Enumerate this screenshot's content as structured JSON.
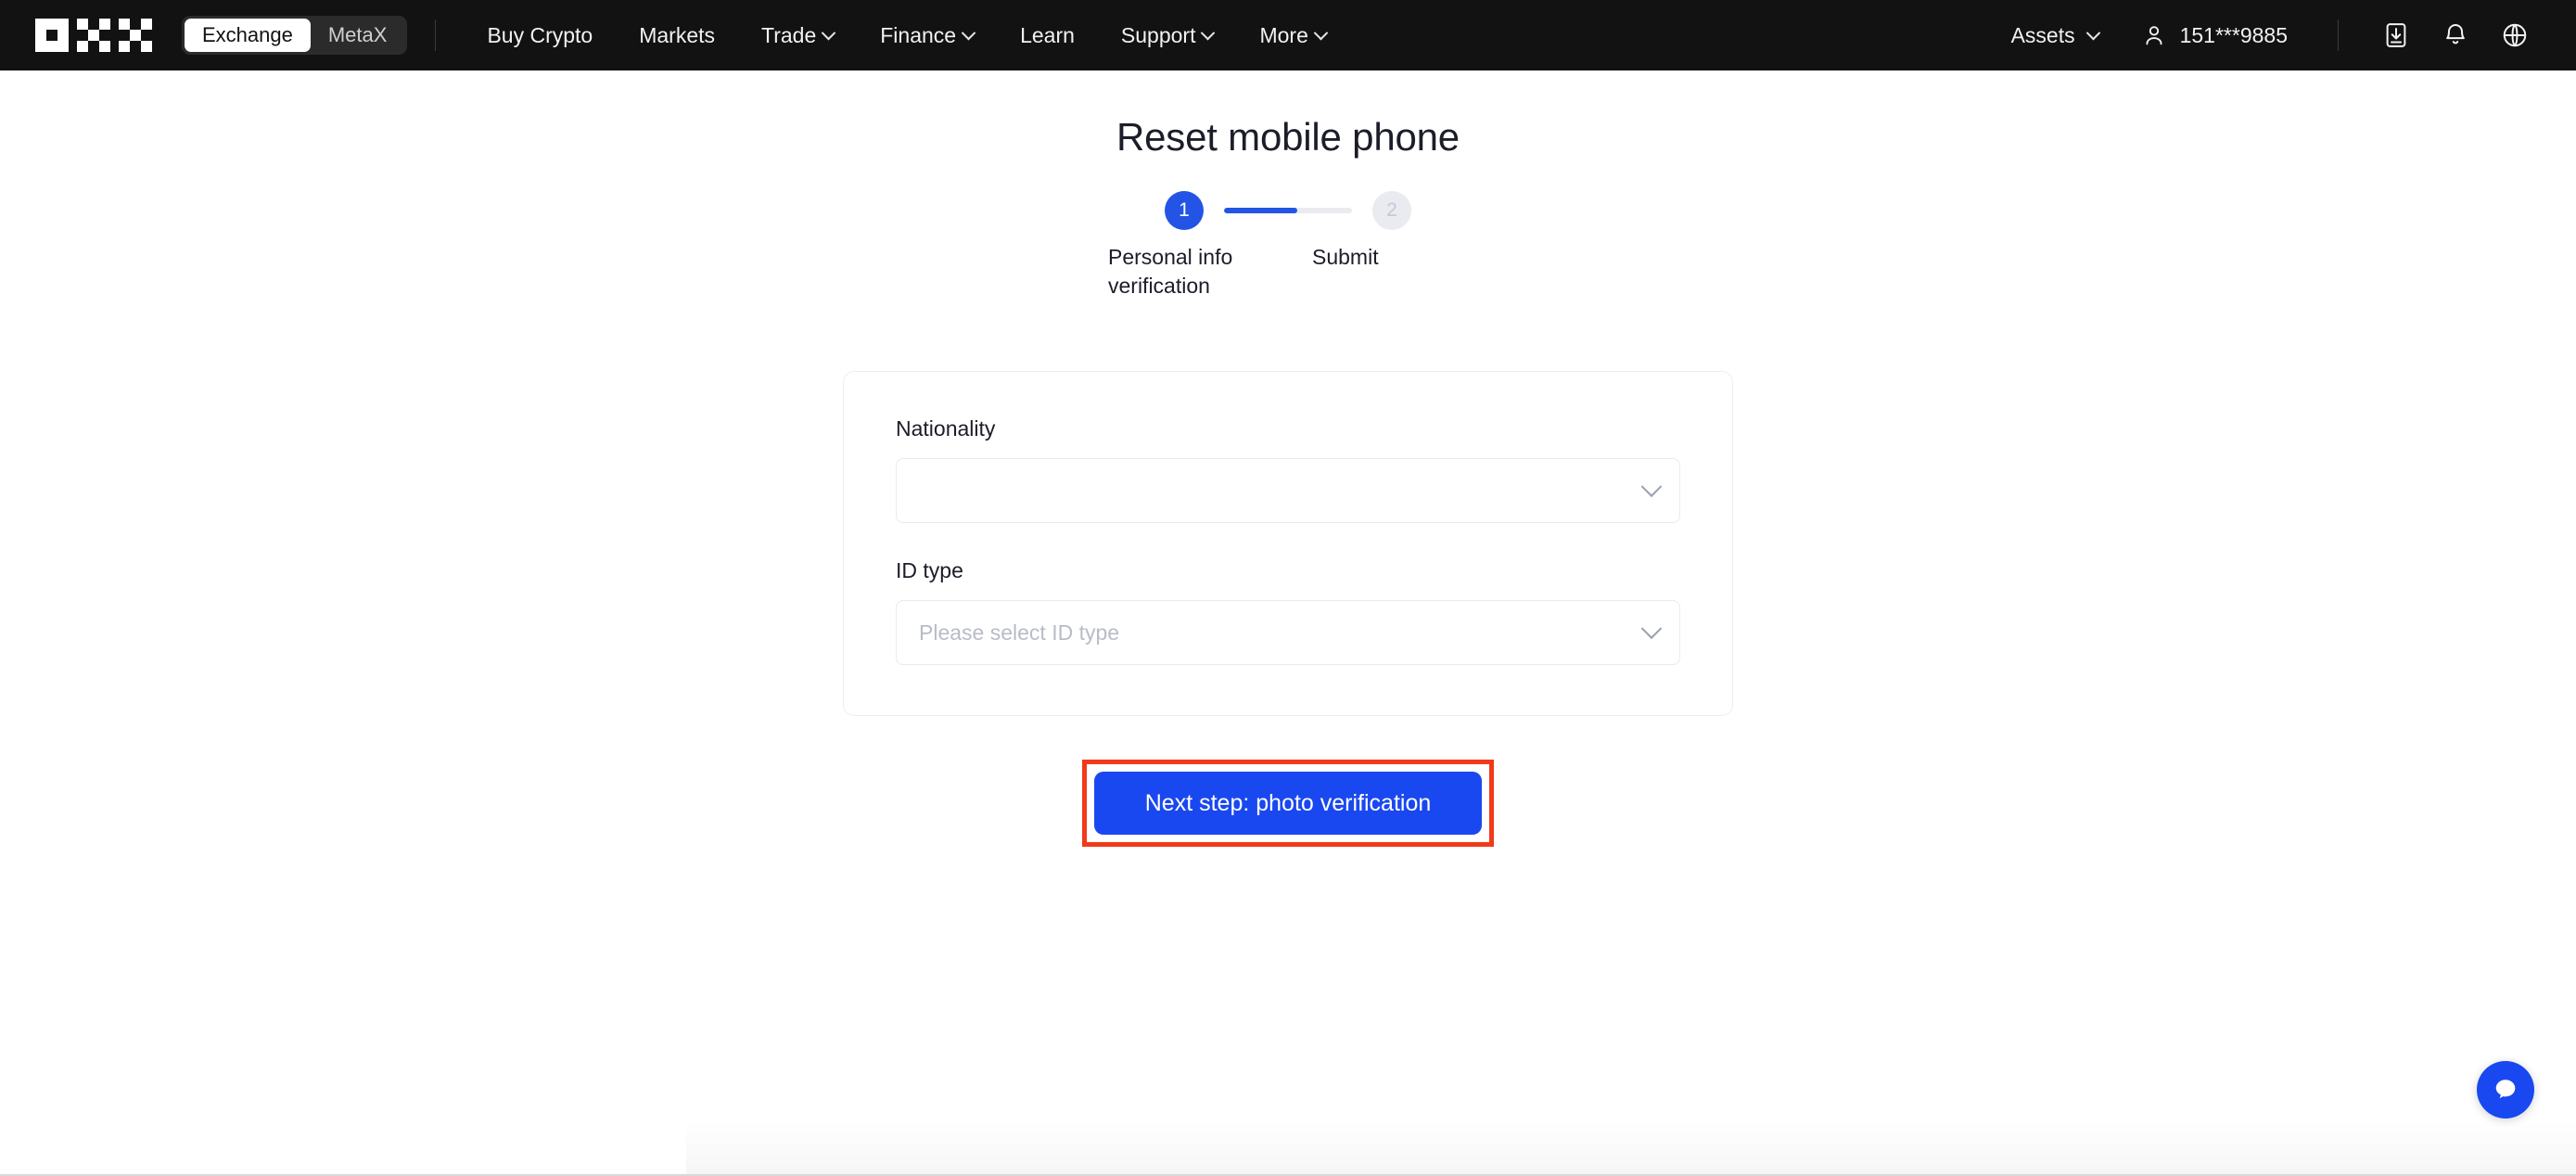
{
  "header": {
    "logo_alt": "OKX",
    "toggle": {
      "options": [
        "Exchange",
        "MetaX"
      ],
      "selected": "Exchange"
    },
    "nav": [
      {
        "label": "Buy Crypto",
        "has_dropdown": false
      },
      {
        "label": "Markets",
        "has_dropdown": false
      },
      {
        "label": "Trade",
        "has_dropdown": true
      },
      {
        "label": "Finance",
        "has_dropdown": true
      },
      {
        "label": "Learn",
        "has_dropdown": false
      },
      {
        "label": "Support",
        "has_dropdown": true
      },
      {
        "label": "More",
        "has_dropdown": true
      }
    ],
    "assets_label": "Assets",
    "account_label": "151***9885",
    "icons": [
      "download-icon",
      "notification-bell-icon",
      "globe-language-icon"
    ]
  },
  "page": {
    "title": "Reset mobile phone"
  },
  "stepper": {
    "steps": [
      {
        "number": "1",
        "label": "Personal info verification",
        "state": "active"
      },
      {
        "number": "2",
        "label": "Submit",
        "state": "inactive"
      }
    ],
    "progress_percent": 57,
    "active_color": "#2354e6",
    "inactive_color": "#e9ebf0"
  },
  "form": {
    "fields": [
      {
        "label": "Nationality",
        "value": "",
        "placeholder": "",
        "control": "dropdown"
      },
      {
        "label": "ID type",
        "value": "",
        "placeholder": "Please select ID type",
        "control": "dropdown"
      }
    ]
  },
  "cta": {
    "label": "Next step: photo verification",
    "button_color": "#1a48f0",
    "highlight_color": "#f03a1a"
  },
  "chat": {
    "name": "chat-support-button"
  }
}
